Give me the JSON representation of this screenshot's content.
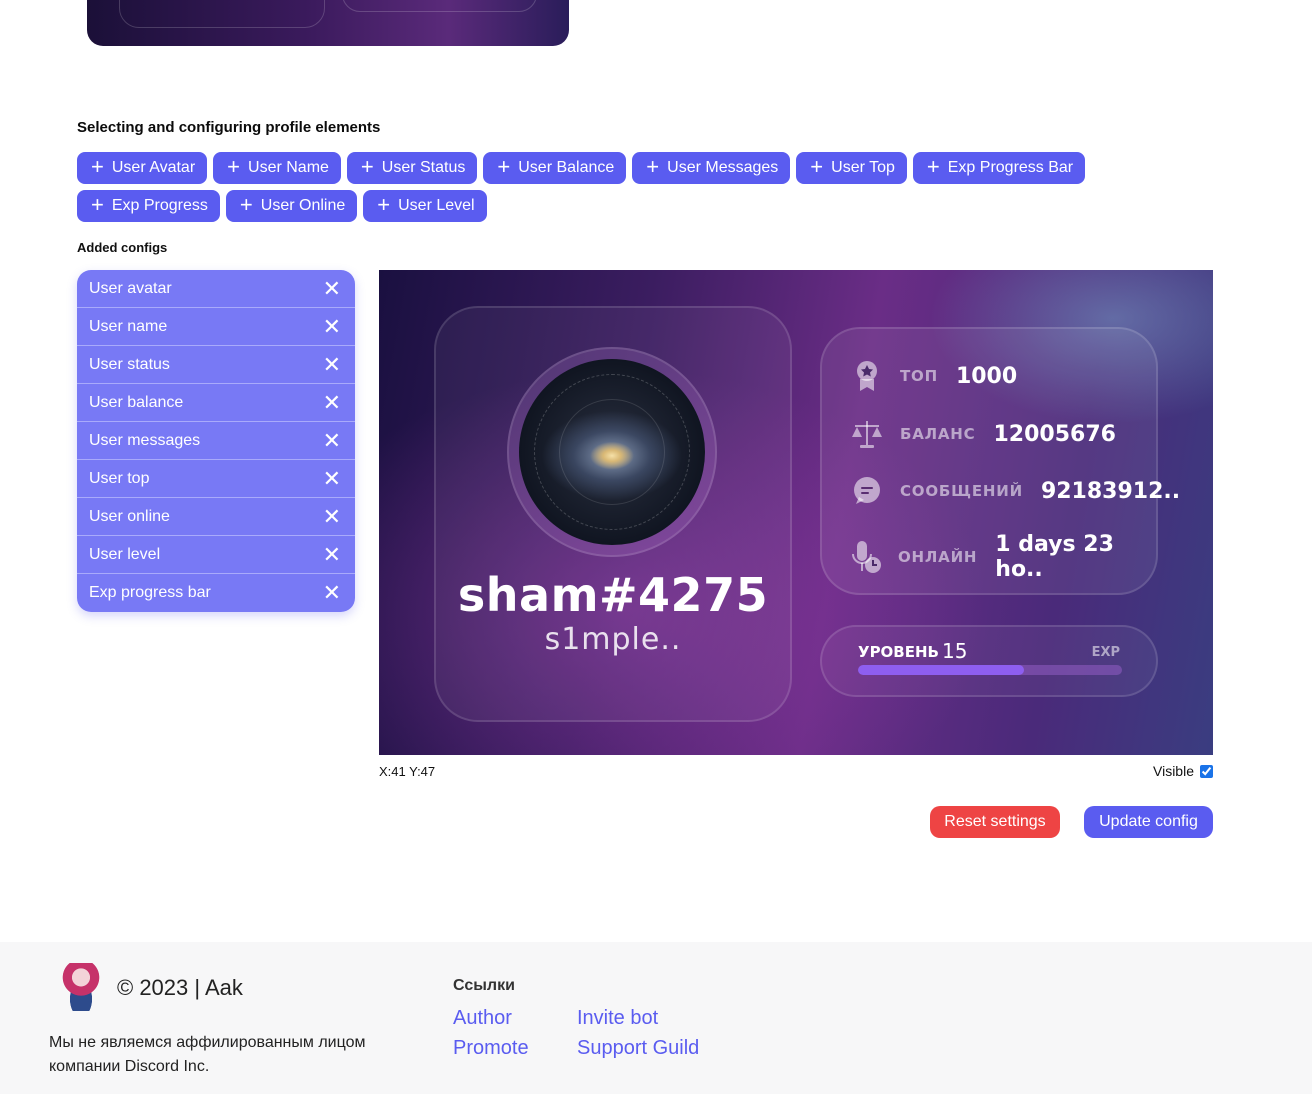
{
  "section_title": "Selecting and configuring profile elements",
  "add_buttons": [
    "User Avatar",
    "User Name",
    "User Status",
    "User Balance",
    "User Messages",
    "User Top",
    "Exp Progress Bar",
    "Exp Progress",
    "User Online",
    "User Level"
  ],
  "added_title": "Added configs",
  "configs": [
    "User avatar",
    "User name",
    "User status",
    "User balance",
    "User messages",
    "User top",
    "User online",
    "User level",
    "Exp progress bar"
  ],
  "preview": {
    "username": "sham#4275",
    "status": "s1mple..",
    "stats": [
      {
        "icon": "medal-icon",
        "label": "ТОП",
        "value": "1000"
      },
      {
        "icon": "scales-icon",
        "label": "БАЛАНС",
        "value": "12005676"
      },
      {
        "icon": "chat-icon",
        "label": "СООБЩЕНИЙ",
        "value": "92183912.."
      },
      {
        "icon": "mic-clock-icon",
        "label": "ОНЛАЙН",
        "value": "1 days 23 ho.."
      }
    ],
    "level_label": "УРОВЕНЬ",
    "level_value": "15",
    "exp_label": "EXP",
    "exp_progress": 0.63
  },
  "coords": "X:41 Y:47",
  "visible_label": "Visible",
  "visible_checked": true,
  "reset_label": "Reset settings",
  "update_label": "Update config",
  "footer": {
    "copyright": "© 2023 | Aak",
    "disclaimer": "Мы не являемся аффилированным лицом компании Discord Inc.",
    "links_title": "Ссылки",
    "links": [
      "Author",
      "Invite bot",
      "Promote",
      "Support Guild"
    ]
  },
  "colors": {
    "accent": "#5a5cf0",
    "danger": "#ee4444",
    "config_item": "#7879f5"
  }
}
